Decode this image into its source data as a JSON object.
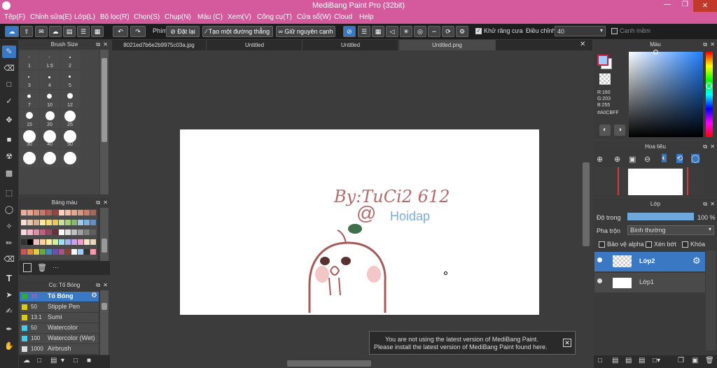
{
  "app": {
    "title": "MediBang Paint Pro (32bit)"
  },
  "menu": [
    "Tệp(F)",
    "Chỉnh sửa(E)",
    "Lớp(L)",
    "Bộ lọc(R)",
    "Chọn(S)",
    "Chụp(N)",
    "Màu (C)",
    "Xem(V)",
    "Công cụ(T)",
    "Cửa sổ(W)",
    "Cloud",
    "Help"
  ],
  "toolbar": {
    "brush_label": "Phím",
    "reset_label": "Đặt lại",
    "line_label": "Tạo một đường thẳng",
    "keep_label": "Giữ nguyên cạnh",
    "antialias_label": "Khử răng cưa",
    "adjust_label": "Điều chỉnh",
    "adjust_value": "40",
    "smooth_label": "Canh mềm"
  },
  "brush_panel": {
    "title": "Brush Size",
    "sizes": [
      "1",
      "1.5",
      "2",
      "3",
      "4",
      "5",
      "7",
      "10",
      "12",
      "15",
      "20",
      "25",
      "30",
      "40",
      "50"
    ]
  },
  "palette_panel": {
    "title": "Bảng màu",
    "colors": [
      "#e8b09a",
      "#e8a590",
      "#d8907a",
      "#c87868",
      "#b06058",
      "#904840",
      "#ffd0c0",
      "#f0c0a8",
      "#e4a890",
      "#d49880",
      "#c48070",
      "#a86858",
      "#f8e0d0",
      "#e8c8b0",
      "#d8b090",
      "#ffe8a0",
      "#f8d878",
      "#e8c860",
      "#c8e0a0",
      "#a8d080",
      "#88b870",
      "#a0c8e8",
      "#80b0e0",
      "#6090c8",
      "#f8d8e0",
      "#f0b8c8",
      "#e090a8",
      "#c06080",
      "#984860",
      "#6a3040",
      "#ffffff",
      "#e0e0e0",
      "#c0c0c0",
      "#a0a0a0",
      "#808080",
      "#606060",
      "#303030",
      "#000000",
      "#f0c0c0",
      "#f8d0a0",
      "#fff0a0",
      "#d0f0a0",
      "#a0e0f0",
      "#a0b8f0",
      "#d0a0f0",
      "#f0a0d0",
      "#f8e8c8",
      "#e8d8b8",
      "#cc5555",
      "#dd8844",
      "#ddcc44",
      "#66aa44",
      "#4488cc",
      "#6655aa",
      "#aa5588",
      "#884433",
      "#ffffff",
      "#a0cbff",
      "#333333",
      "#ff99aa"
    ]
  },
  "cursor_panel": {
    "title": "Cọ: Tố Bóng",
    "items": [
      {
        "size": "10",
        "name": "Tố Bóng",
        "color": "#33aa33"
      },
      {
        "size": "50",
        "name": "Stipple Pen",
        "color": "#ddcc00"
      },
      {
        "size": "13.1",
        "name": "Sumi",
        "color": "#ddcc00"
      },
      {
        "size": "50",
        "name": "Watercolor",
        "color": "#44ccee"
      },
      {
        "size": "100",
        "name": "Watercolor (Wet)",
        "color": "#44ccee"
      },
      {
        "size": "1000",
        "name": "Airbrush",
        "color": "#dddddd"
      }
    ]
  },
  "tabs": [
    "8021ed7b6e2b9975c03a.jpg",
    "Untitled",
    "Untitled",
    "Untitled.png"
  ],
  "canvas_text": {
    "line1": "By:TuCi2 612",
    "at": "@",
    "hoidap": "Hoidap"
  },
  "notice": {
    "line1": "You are not using the latest version of MediBang Paint.",
    "line2": "Please install the latest version of MediBang Paint found here."
  },
  "color_panel": {
    "title": "Màu",
    "r": "R:160",
    "g": "G:203",
    "b": "B:255",
    "hex": "#A0CBFF"
  },
  "nav_panel": {
    "title": "Hoa tiêu"
  },
  "layer_panel": {
    "title": "Lớp",
    "opacity_label": "Độ trong",
    "opacity_value": "100 %",
    "opacity_fraction": 1.0,
    "blend_label": "Pha trộn",
    "blend_value": "Bình thường",
    "protect_label": "Bảo vệ alpha",
    "clip_label": "Xén bớt",
    "lock_label": "Khóa",
    "layers": [
      {
        "name": "Lớp2"
      },
      {
        "name": "Lớp1"
      }
    ]
  },
  "colors": {
    "titlebar": "#d55a9d",
    "accent": "#3a78c4",
    "fg": "#a0cbff"
  }
}
